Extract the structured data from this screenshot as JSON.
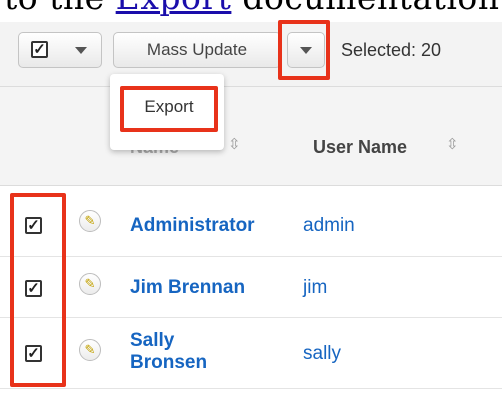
{
  "doc": {
    "prefix": "to the ",
    "link": "Export",
    "suffix": " documentation."
  },
  "toolbar": {
    "mass_update_label": "Mass Update",
    "selected_label": "Selected: 20"
  },
  "dropdown": {
    "export_label": "Export"
  },
  "columns": {
    "name": "Name",
    "user_name": "User Name"
  },
  "rows": [
    {
      "name": "Administrator",
      "user_name": "admin",
      "checked": true
    },
    {
      "name": "Jim Brennan",
      "user_name": "jim",
      "checked": true
    },
    {
      "name": "Sally Bronsen",
      "user_name": "sally",
      "checked": true
    }
  ],
  "colors": {
    "highlight": "#e8321a",
    "link": "#1665c1"
  },
  "icons": [
    "check-icon",
    "caret-down-icon",
    "sort-icon",
    "pencil-icon"
  ]
}
